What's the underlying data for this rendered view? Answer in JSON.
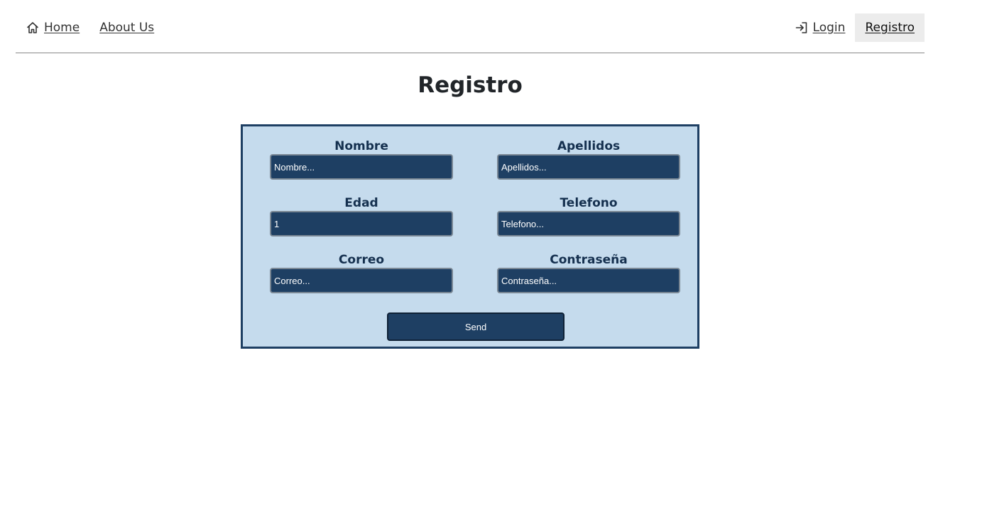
{
  "nav": {
    "home_label": "Home",
    "home_icon": "home-icon",
    "about_label": "About Us",
    "login_label": "Login",
    "login_icon": "login-icon",
    "registro_label": "Registro"
  },
  "page": {
    "title": "Registro"
  },
  "form": {
    "nombre": {
      "label": "Nombre",
      "placeholder": "Nombre...",
      "value": ""
    },
    "apellidos": {
      "label": "Apellidos",
      "placeholder": "Apellidos...",
      "value": ""
    },
    "edad": {
      "label": "Edad",
      "placeholder": "",
      "value": "1"
    },
    "telefono": {
      "label": "Telefono",
      "placeholder": "Telefono...",
      "value": ""
    },
    "correo": {
      "label": "Correo",
      "placeholder": "Correo...",
      "value": ""
    },
    "contrasena": {
      "label": "Contraseña",
      "placeholder": "Contraseña...",
      "value": ""
    },
    "send_label": "Send"
  },
  "colors": {
    "form_background": "#c5dbed",
    "form_border": "#1e3f63",
    "input_background": "#1e3f63",
    "label_text": "#15304f"
  }
}
